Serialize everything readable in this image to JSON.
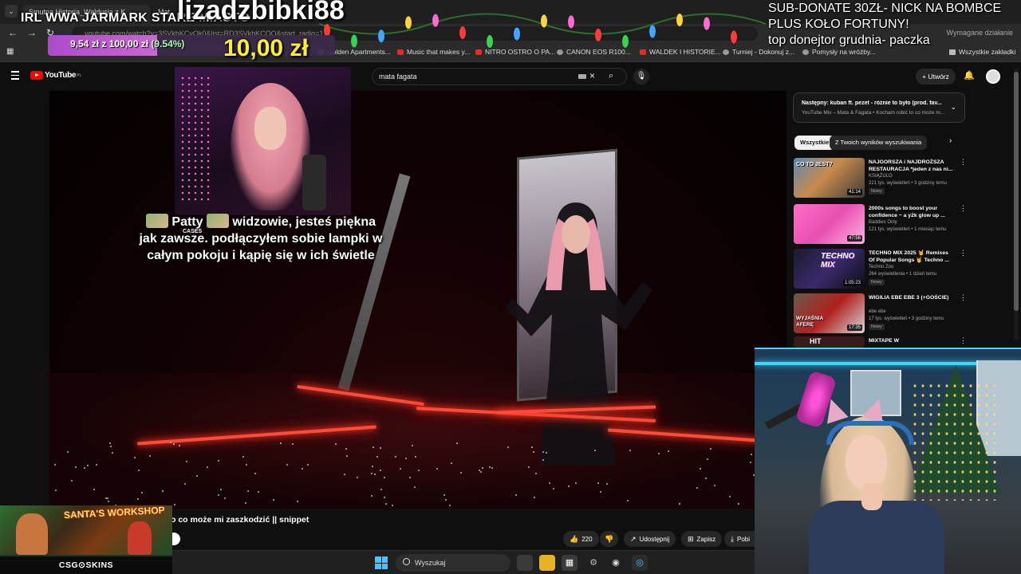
{
  "browser": {
    "tabs": [
      {
        "label": "Smutna Historia_Waldusia z K"
      },
      {
        "label": "Mat"
      }
    ],
    "url": "youtube.com/watch?v=3SVkbKCyOk0&list=RD3SVkbKCOO&start_radio=1",
    "address_right": "Wymagane działanie",
    "bookmarks": [
      {
        "label": "Golden Apartments..."
      },
      {
        "label": "Music that makes y..."
      },
      {
        "label": "NITRO OSTRO O PA..."
      },
      {
        "label": "CANON EOS R100..."
      },
      {
        "label": "WALDEK I HISTORIE..."
      },
      {
        "label": "Turniej - Dokonuj z..."
      },
      {
        "label": "Pomysły na wróżby..."
      },
      {
        "label": "Wszystkie zakładki"
      }
    ]
  },
  "stream_overlay": {
    "title": "IRL WWA JARMARK STARE MIASTO",
    "donor_name": "lizadzbibki88",
    "goal_progress_text": "9,54 zł z 100,00 zł",
    "goal_percent_text": "(9.54%)",
    "goal_progress_fraction": 0.0954,
    "donation_amount": "10,00 zł",
    "sub_info_lines": [
      "SUB-DONATE 30ZŁ- NICK NA BOMBCE",
      "PLUS KOŁO FORTUNY!",
      "top donejtor grudnia- paczka"
    ],
    "donation_message": {
      "part1": "Patty",
      "part2": "widzowie, jesteś piękna jak zawsze. podłączyłem sobie lampki w całym pokoju i kąpię się w ich świetle"
    },
    "emote_label": "CASES"
  },
  "youtube": {
    "logo_text": "YouTube",
    "logo_region": "PL",
    "search_query": "mata fagata",
    "create_label": "Utwórz",
    "video_title": "o co może mi zaszkodzić || snippet",
    "actions": {
      "likes": "220",
      "share": "Udostępnij",
      "save": "Zapisz",
      "download": "Pobi"
    },
    "next_up": {
      "title": "Następny: kuban ft. pezet - różnie to było (prod. fav...",
      "subtitle": "YouTube Mix – Mata & Fagata • Kocham robić to co może m..."
    },
    "chips": [
      "Wszystkie",
      "Z Twoich wyników wyszukiwania"
    ],
    "recommendations": [
      {
        "title": "NAJGORSZA i NAJDROŻSZA RESTAURACJA *jeden z nas ni...",
        "channel": "KSIĄŻULO",
        "meta": "221 tys. wyświetleń • 3 godziny temu",
        "badge": "Nowy",
        "duration": "41:14",
        "thumb_text": "CO TO JEST?"
      },
      {
        "title": "2000s songs to boost your confidence ~ a y2k glow up ...",
        "channel": "Baddies Only",
        "meta": "121 tys. wyświetleń • 1 miesiąc temu",
        "badge": "",
        "duration": "47:56",
        "thumb_text": ""
      },
      {
        "title": "TECHNO MIX 2025 🤘 Remixes Of Popular Songs 🤘 Techno ...",
        "channel": "Techno Zoo",
        "meta": "264 wyświetlenia • 1 dzień temu",
        "badge": "Nowy",
        "duration": "1:05:23",
        "thumb_text": "TECHNO MIX"
      },
      {
        "title": "WIGILIA EBE EBE 3 (+GOŚCIE)",
        "channel": "ebe ebe",
        "meta": "17 tys. wyświetleń • 3 godziny temu",
        "badge": "Nowy",
        "duration": "17:35",
        "thumb_text": "WYJAŚNIA AFERĘ"
      },
      {
        "title": "MIXTAPE W",
        "channel": "",
        "meta": "",
        "badge": "",
        "duration": "",
        "thumb_text": "HIT"
      }
    ]
  },
  "ad": {
    "title": "SANTA'S WORKSHOP",
    "brand": "CSG⊙SKINS"
  },
  "taskbar": {
    "search_placeholder": "Wyszukaj"
  },
  "colors": {
    "youtube_red": "#ff0000",
    "goal_bar": "#b64ed6",
    "donation_amount": "#ffef2a",
    "windows_accent": "#4cc2ff"
  }
}
